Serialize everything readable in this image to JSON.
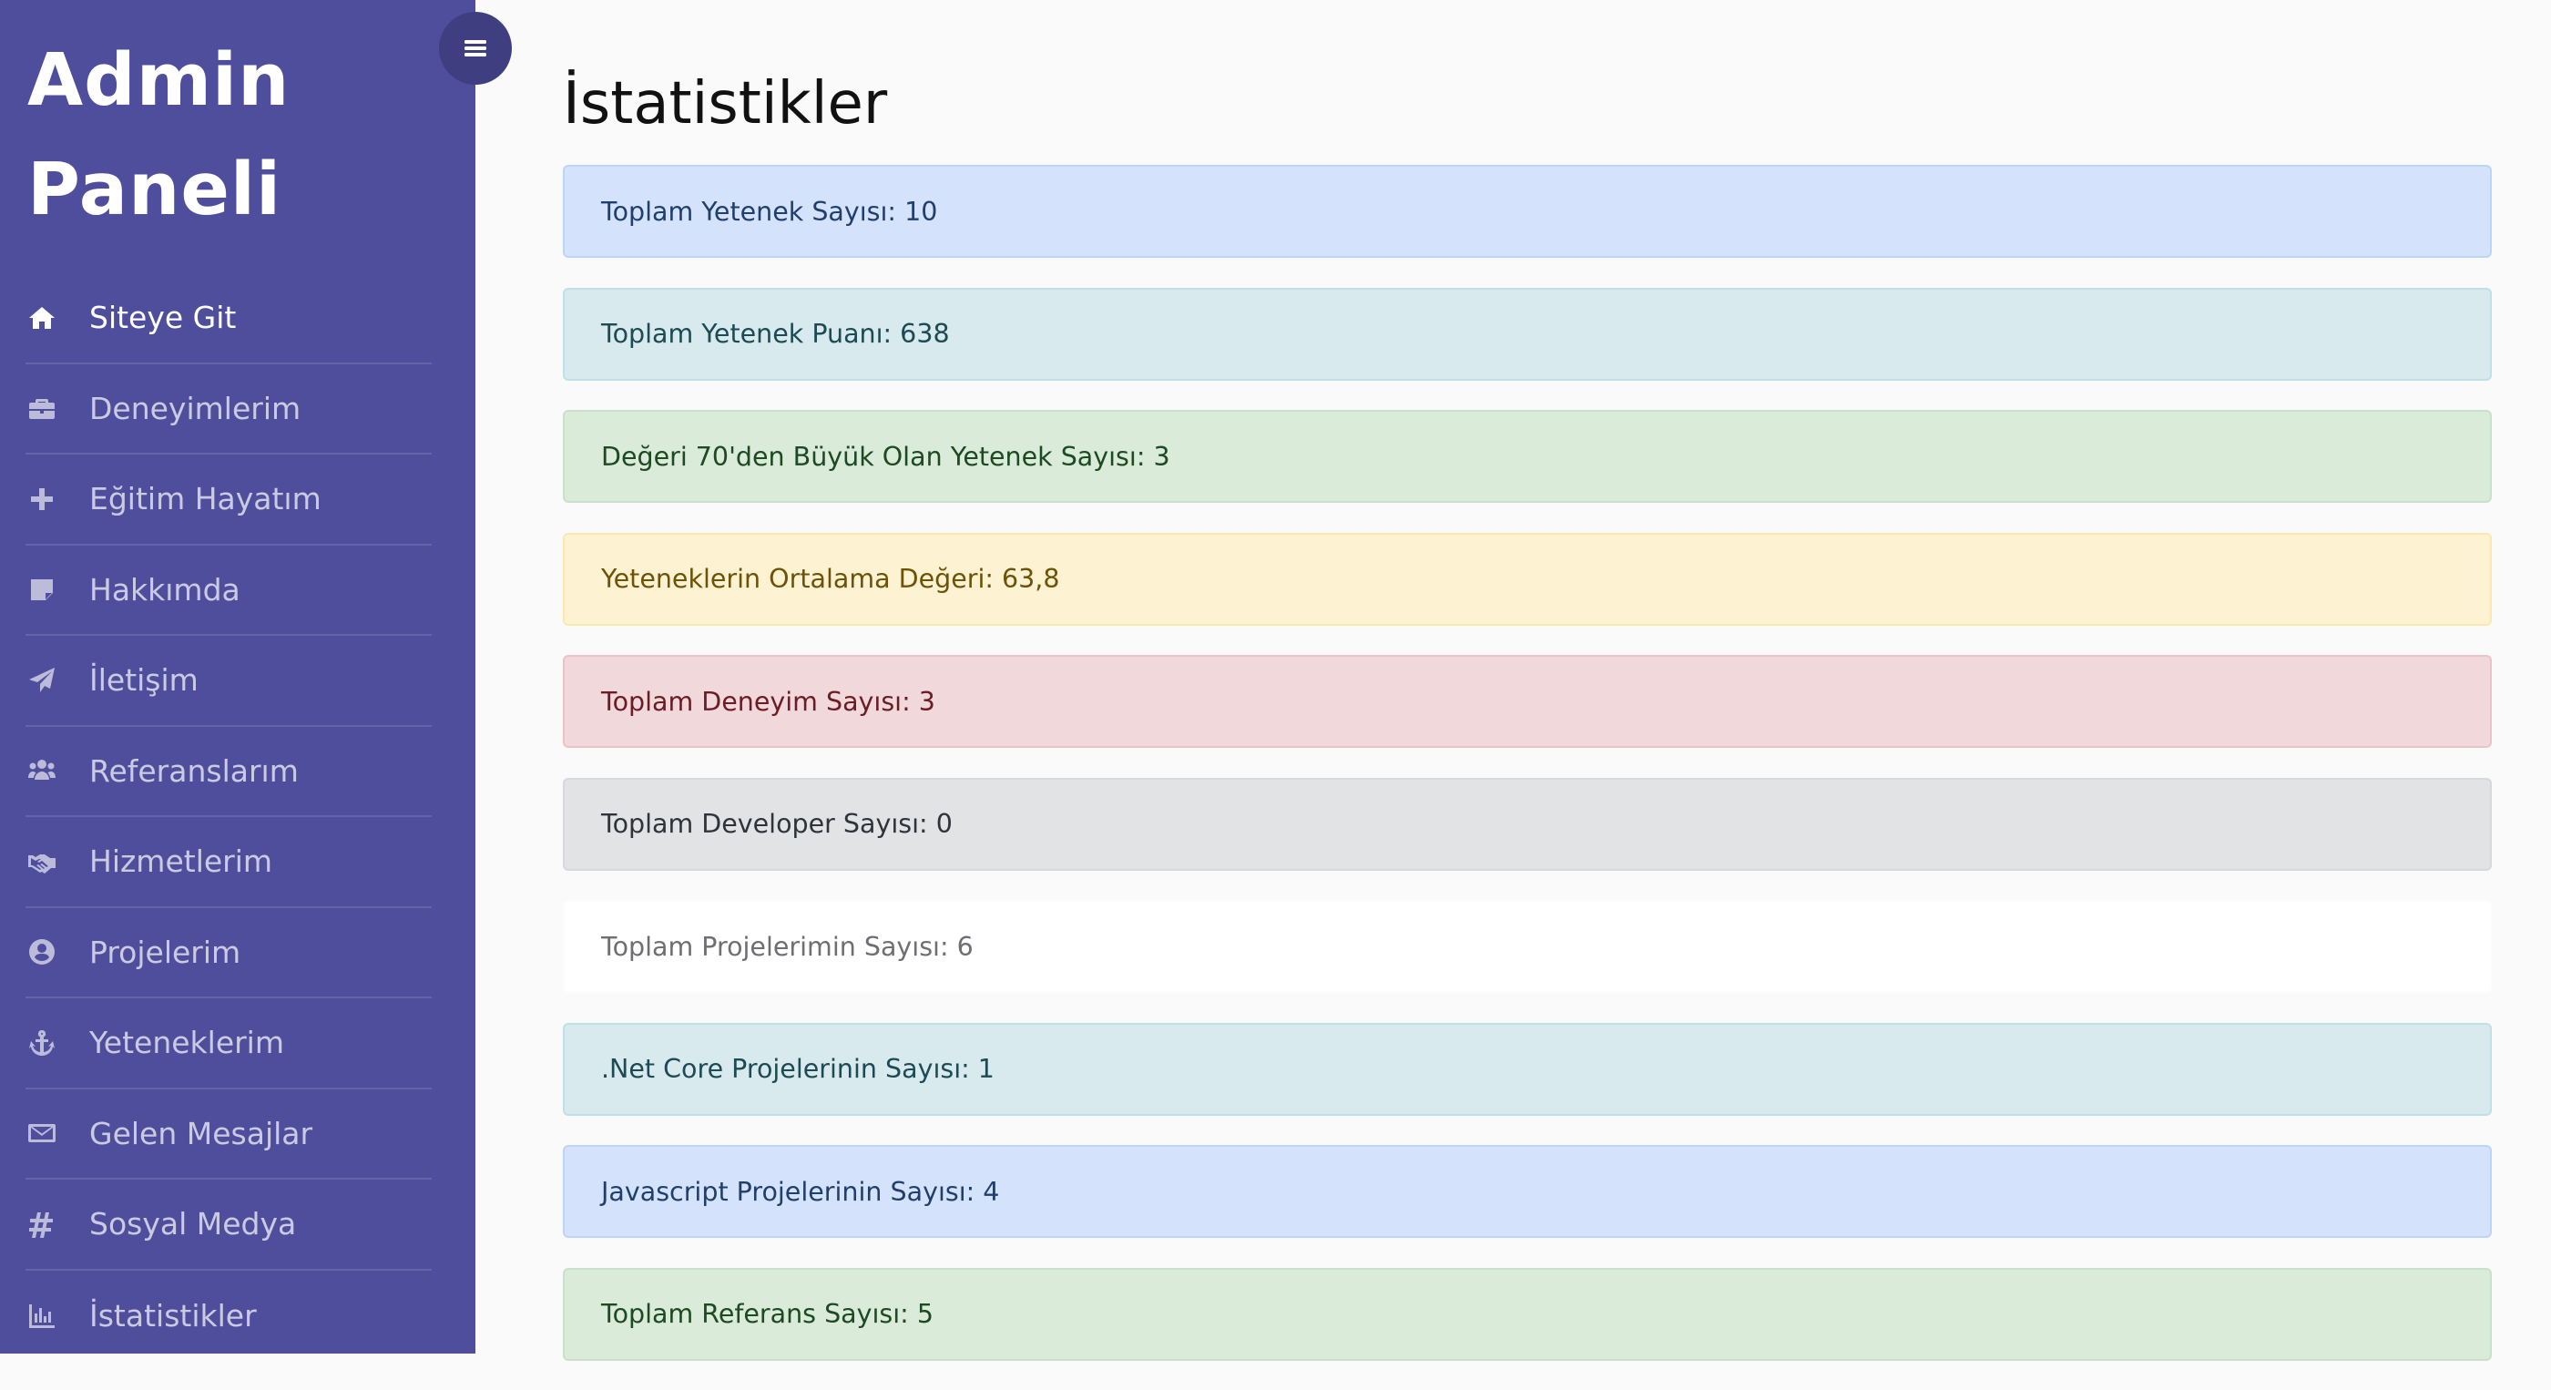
{
  "sidebar": {
    "brand_line1": "Admin",
    "brand_line2": "Paneli",
    "items": [
      {
        "label": "Siteye Git",
        "icon": "home-icon",
        "active": true
      },
      {
        "label": "Deneyimlerim",
        "icon": "briefcase-icon",
        "active": false
      },
      {
        "label": "Eğitim Hayatım",
        "icon": "plus-icon",
        "active": false
      },
      {
        "label": "Hakkımda",
        "icon": "sticky-note-icon",
        "active": false
      },
      {
        "label": "İletişim",
        "icon": "paper-plane-icon",
        "active": false
      },
      {
        "label": "Referanslarım",
        "icon": "users-icon",
        "active": false
      },
      {
        "label": "Hizmetlerim",
        "icon": "handshake-icon",
        "active": false
      },
      {
        "label": "Projelerim",
        "icon": "user-circle-icon",
        "active": false
      },
      {
        "label": "Yeteneklerim",
        "icon": "anchor-icon",
        "active": false
      },
      {
        "label": "Gelen Mesajlar",
        "icon": "envelope-icon",
        "active": false
      },
      {
        "label": "Sosyal Medya",
        "icon": "hashtag-icon",
        "active": false
      },
      {
        "label": "İstatistikler",
        "icon": "bar-chart-icon",
        "active": false
      }
    ]
  },
  "header": {
    "toggle_icon": "hamburger-menu-icon"
  },
  "main": {
    "title": "İstatistikler",
    "stats": [
      {
        "text": "Toplam Yetenek Sayısı: 10",
        "variant": "primary"
      },
      {
        "text": "Toplam Yetenek Puanı: 638",
        "variant": "info"
      },
      {
        "text": "Değeri 70'den Büyük Olan Yetenek Sayısı: 3",
        "variant": "success"
      },
      {
        "text": "Yeteneklerin Ortalama Değeri: 63,8",
        "variant": "warning"
      },
      {
        "text": "Toplam Deneyim Sayısı: 3",
        "variant": "danger"
      },
      {
        "text": "Toplam Developer Sayısı: 0",
        "variant": "secondary"
      },
      {
        "text": "Toplam Projelerimin Sayısı: 6",
        "variant": "light"
      },
      {
        "text": ".Net Core Projelerinin Sayısı: 1",
        "variant": "info"
      },
      {
        "text": "Javascript Projelerinin Sayısı: 4",
        "variant": "primary"
      },
      {
        "text": "Toplam Referans Sayısı: 5",
        "variant": "success"
      }
    ]
  },
  "colors": {
    "sidebar_bg": "#4f4e9d",
    "toggle_bg": "#3f3e80",
    "page_bg": "#fafafa"
  }
}
